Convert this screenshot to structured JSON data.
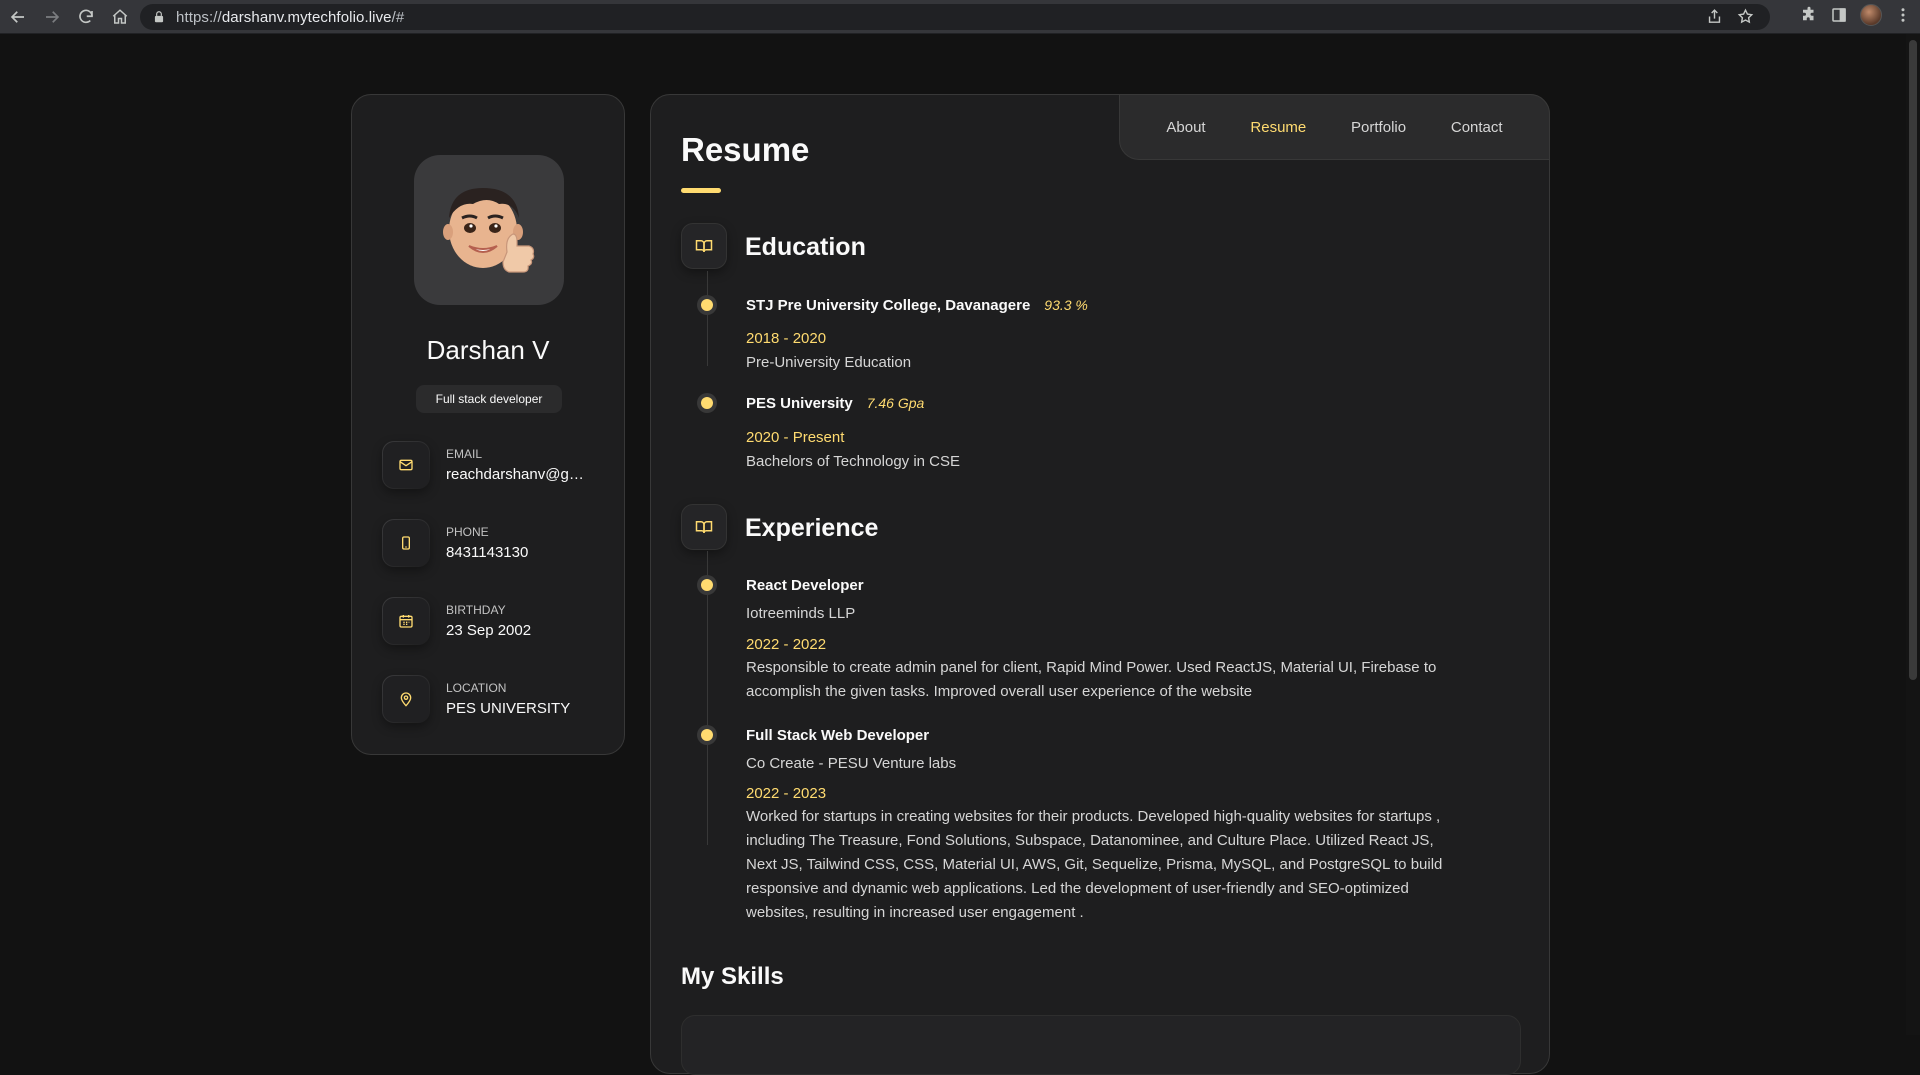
{
  "browser": {
    "url_prefix": "https://",
    "url_domain": "darshanv.mytechfolio.live",
    "url_suffix": "/#"
  },
  "profile": {
    "name": "Darshan V",
    "title": "Full stack developer",
    "contacts": [
      {
        "label": "EMAIL",
        "value": "reachdarshanv@gmail.com",
        "icon": "mail-icon"
      },
      {
        "label": "PHONE",
        "value": "8431143130",
        "icon": "phone-icon"
      },
      {
        "label": "BIRTHDAY",
        "value": "23 Sep 2002",
        "icon": "calendar-icon"
      },
      {
        "label": "LOCATION",
        "value": "PES UNIVERSITY",
        "icon": "location-pin-icon"
      }
    ]
  },
  "nav": {
    "items": [
      "About",
      "Resume",
      "Portfolio",
      "Contact"
    ],
    "active": "Resume"
  },
  "resume": {
    "title": "Resume",
    "education": {
      "title": "Education",
      "items": [
        {
          "name": "STJ Pre University College, Davanagere",
          "score": "93.3 %",
          "date": "2018 - 2020",
          "desc": "Pre-University Education"
        },
        {
          "name": "PES University",
          "score": "7.46 Gpa",
          "date": "2020 - Present",
          "desc": "Bachelors of Technology in CSE"
        }
      ]
    },
    "experience": {
      "title": "Experience",
      "items": [
        {
          "role": "React Developer",
          "company": "Iotreeminds LLP",
          "date": "2022 - 2022",
          "desc": "Responsible to create admin panel for client, Rapid Mind Power. Used ReactJS, Material UI, Firebase to accomplish the given tasks. Improved overall user experience of the website"
        },
        {
          "role": "Full Stack Web Developer",
          "company": "Co Create - PESU Venture labs",
          "date": "2022 - 2023",
          "desc": "Worked for startups in creating websites for their products. Developed high-quality websites for startups , including The Treasure, Fond Solutions, Subspace, Datanominee, and Culture Place. Utilized React JS, Next JS, Tailwind CSS, CSS, Material UI, AWS, Git, Sequelize, Prisma, MySQL, and PostgreSQL to build responsive and dynamic web applications. Led the development of user-friendly and SEO-optimized websites, resulting in increased user engagement ."
        }
      ]
    },
    "skills_title": "My Skills"
  },
  "colors": {
    "accent": "#ffdb70",
    "card_bg": "#1e1e1f",
    "page_bg": "#121212"
  }
}
